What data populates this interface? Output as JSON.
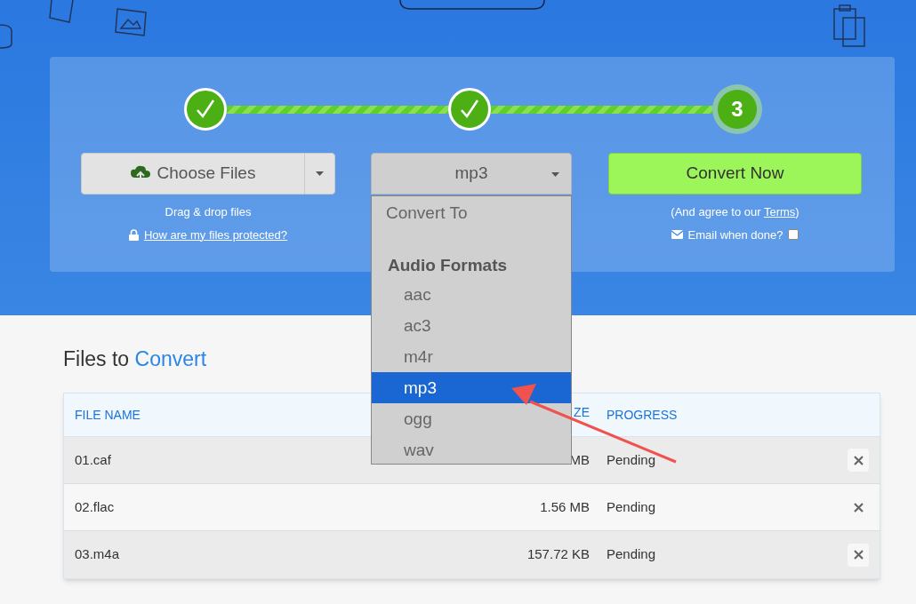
{
  "steps": [
    {
      "kind": "done"
    },
    {
      "kind": "done"
    },
    {
      "kind": "current",
      "label": "3"
    }
  ],
  "choose_files": {
    "label": "Choose Files"
  },
  "drag_hint": "Drag & drop files",
  "protection_link": "How are my files protected?",
  "format_select": {
    "value": "mp3",
    "expanded": true
  },
  "format_menu": {
    "heading": "Convert To",
    "groups": [
      {
        "label": "Audio Formats",
        "options": [
          {
            "label": "aac",
            "selected": false
          },
          {
            "label": "ac3",
            "selected": false
          },
          {
            "label": "m4r",
            "selected": false
          },
          {
            "label": "mp3",
            "selected": true
          },
          {
            "label": "ogg",
            "selected": false
          },
          {
            "label": "wav",
            "selected": false
          }
        ]
      }
    ]
  },
  "convert_button": "Convert Now",
  "terms": {
    "before": "(And agree to our ",
    "link": "Terms",
    "after": ")"
  },
  "email": {
    "label": "Email when done?",
    "checked": false
  },
  "files_title": {
    "text": "Files to",
    "accent": "Convert"
  },
  "table": {
    "columns": [
      "FILE NAME",
      "ZE",
      "PROGRESS"
    ],
    "rows": [
      {
        "name": "01.caf",
        "size": "MB",
        "progress": "Pending"
      },
      {
        "name": "02.flac",
        "size": "1.56 MB",
        "progress": "Pending"
      },
      {
        "name": "03.m4a",
        "size": "157.72 KB",
        "progress": "Pending"
      }
    ]
  }
}
